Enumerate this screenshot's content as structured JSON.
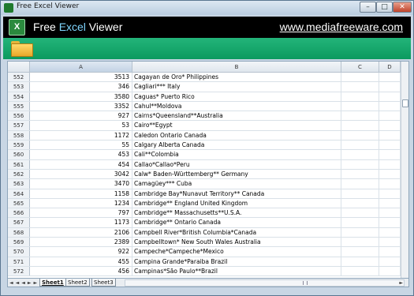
{
  "window": {
    "title": "Free Excel Viewer",
    "buttons": {
      "minimize": "–",
      "maximize": "□",
      "close": "✕"
    }
  },
  "header": {
    "title_left": "Free ",
    "title_mid": "Excel",
    "title_right": " Viewer",
    "website": "www.mediafreeware.com",
    "logo_letter": "X"
  },
  "toolbar": {
    "icon": "open-folder-icon"
  },
  "columns": [
    "A",
    "B",
    "C",
    "D"
  ],
  "rows": [
    {
      "n": "552",
      "a": "3513",
      "b": "Cagayan de Oro* Philippines"
    },
    {
      "n": "553",
      "a": "346",
      "b": "Cagliari*** Italy"
    },
    {
      "n": "554",
      "a": "3580",
      "b": "Caguas* Puerto Rico"
    },
    {
      "n": "555",
      "a": "3352",
      "b": "Cahul**Moldova"
    },
    {
      "n": "556",
      "a": "927",
      "b": "Cairns*Queensland**Australia"
    },
    {
      "n": "557",
      "a": "53",
      "b": "Cairo**Egypt"
    },
    {
      "n": "558",
      "a": "1172",
      "b": "Caledon Ontario Canada"
    },
    {
      "n": "559",
      "a": "55",
      "b": "Calgary Alberta Canada"
    },
    {
      "n": "560",
      "a": "453",
      "b": "Cali**Colombia"
    },
    {
      "n": "561",
      "a": "454",
      "b": "Callao*Callao*Peru"
    },
    {
      "n": "562",
      "a": "3042",
      "b": "Calw* Baden-Württemberg** Germany"
    },
    {
      "n": "563",
      "a": "3470",
      "b": "Camagüey*** Cuba"
    },
    {
      "n": "564",
      "a": "1158",
      "b": "Cambridge Bay*Nunavut Territory** Canada"
    },
    {
      "n": "565",
      "a": "1234",
      "b": "Cambridge** England United Kingdom"
    },
    {
      "n": "566",
      "a": "797",
      "b": "Cambridge** Massachusetts**U.S.A."
    },
    {
      "n": "567",
      "a": "1173",
      "b": "Cambridge** Ontario Canada"
    },
    {
      "n": "568",
      "a": "2106",
      "b": "Campbell River*British Columbia*Canada"
    },
    {
      "n": "569",
      "a": "2389",
      "b": "Campbelltown* New South Wales Australia"
    },
    {
      "n": "570",
      "a": "922",
      "b": "Campeche*Campeche*Mexico"
    },
    {
      "n": "571",
      "a": "455",
      "b": "Campina Grande*Paraiba Brazil"
    },
    {
      "n": "572",
      "a": "456",
      "b": "Campinas*São Paulo**Brazil"
    }
  ],
  "sheet_tabs": [
    "Sheet1",
    "Sheet2",
    "Sheet3"
  ],
  "active_sheet": "Sheet1",
  "colors": {
    "header_bg": "#000000",
    "toolbar_green": "#12a66a",
    "accent_blue": "#7fd6ff"
  }
}
